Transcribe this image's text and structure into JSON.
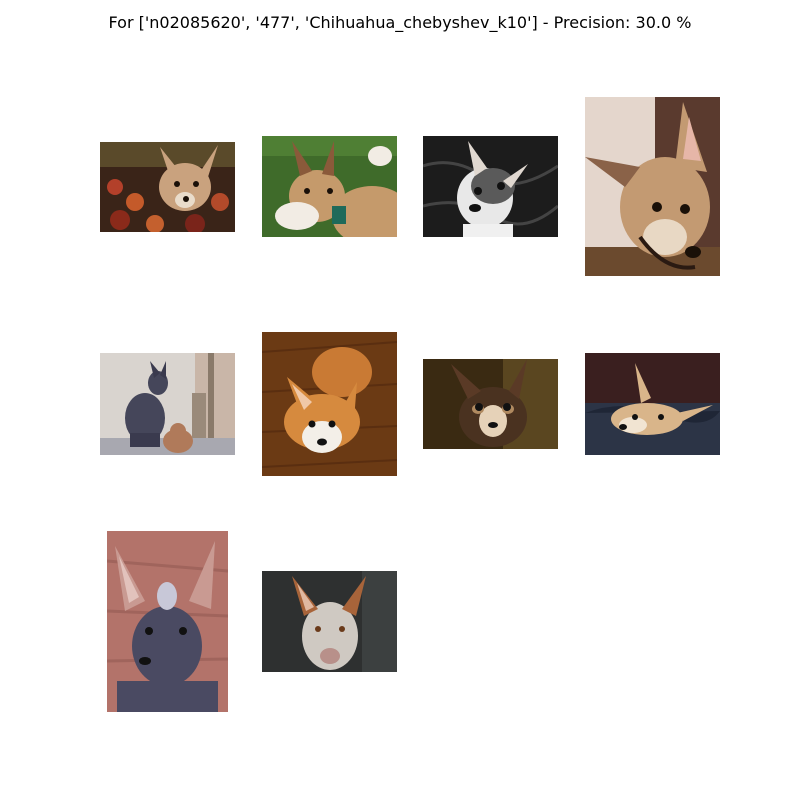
{
  "figure": {
    "title": "For ['n02085620', '477', 'Chihuahua_chebyshev_k10'] - Precision: 30.0 %"
  },
  "images": [
    {
      "subject": "chihuahua lying on a knitted blanket",
      "palette": [
        "#5a3a28",
        "#c9a27e",
        "#7a2a1a"
      ]
    },
    {
      "subject": "tan and white dog on green grass",
      "palette": [
        "#3f6b2a",
        "#c59a6b",
        "#f2ece4"
      ]
    },
    {
      "subject": "black and white chihuahua face on dark floor",
      "palette": [
        "#1c1c1c",
        "#e8e8e8",
        "#5a5a5a"
      ]
    },
    {
      "subject": "tan dog head close-up on couch",
      "palette": [
        "#d8c7b8",
        "#c39a72",
        "#6b4a3a"
      ]
    },
    {
      "subject": "hairless dog sitting next to small dog",
      "palette": [
        "#d9d4cf",
        "#45465a",
        "#b07a5a"
      ]
    },
    {
      "subject": "corgi lying on wooden floor",
      "palette": [
        "#6b3a14",
        "#d68a3e",
        "#f3efe8"
      ]
    },
    {
      "subject": "chihuahua face on dark background",
      "palette": [
        "#3a2a12",
        "#6b4a2a",
        "#e6d2b8"
      ]
    },
    {
      "subject": "tan dog peeking from blue bedding",
      "palette": [
        "#3a1f1f",
        "#2c3446",
        "#d9b58a"
      ]
    },
    {
      "subject": "hairless dog portrait against wood",
      "palette": [
        "#b3736a",
        "#4a4a62",
        "#c99a92"
      ]
    },
    {
      "subject": "pale dog with large ears on dark background",
      "palette": [
        "#2e3030",
        "#cfc9c2",
        "#a8643a"
      ]
    }
  ]
}
